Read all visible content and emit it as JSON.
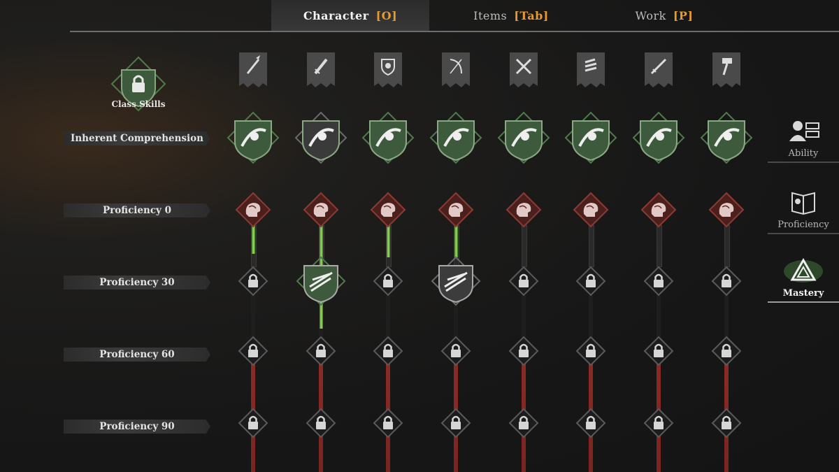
{
  "nav": {
    "tabs": [
      {
        "label": "Character",
        "key": "[O]"
      },
      {
        "label": "Items",
        "key": "[Tab]"
      },
      {
        "label": "Work",
        "key": "[P]"
      }
    ]
  },
  "class_skills": {
    "label": "Class Skills"
  },
  "rows": [
    {
      "label": "Inherent Comprehension"
    },
    {
      "label": "Proficiency 0"
    },
    {
      "label": "Proficiency 30"
    },
    {
      "label": "Proficiency 60"
    },
    {
      "label": "Proficiency 90"
    }
  ],
  "weapons": [
    {
      "icon": "spear-icon",
      "skill": "spear-skill-icon",
      "prof": 0.7
    },
    {
      "icon": "sword-icon",
      "skill": "blade-skill-icon",
      "prof": 1.0,
      "p30": "unlocked-green"
    },
    {
      "icon": "shield-icon",
      "skill": "shield-skill-icon",
      "prof": 0.8
    },
    {
      "icon": "bow-icon",
      "skill": "archer-skill-icon",
      "prof": 0.8,
      "p30": "unlocked-gray"
    },
    {
      "icon": "dual-blades-icon",
      "skill": "dual-skill-icon",
      "prof": 0
    },
    {
      "icon": "claw-icon",
      "skill": "claw-skill-icon",
      "prof": 0
    },
    {
      "icon": "longsword-icon",
      "skill": "longsword-skill-icon",
      "prof": 0
    },
    {
      "icon": "hammer-icon",
      "skill": "fist-skill-icon",
      "prof": 0
    }
  ],
  "sidebar": [
    {
      "label": "Ability",
      "icon": "ability-icon",
      "active": false
    },
    {
      "label": "Proficiency",
      "icon": "proficiency-book-icon",
      "active": false
    },
    {
      "label": "Mastery",
      "icon": "mastery-icon",
      "active": true
    }
  ],
  "colors": {
    "accent": "#e89a2c",
    "green": "#7cc24a",
    "red": "#8e2b26",
    "node_green": "#3e5a3c"
  }
}
